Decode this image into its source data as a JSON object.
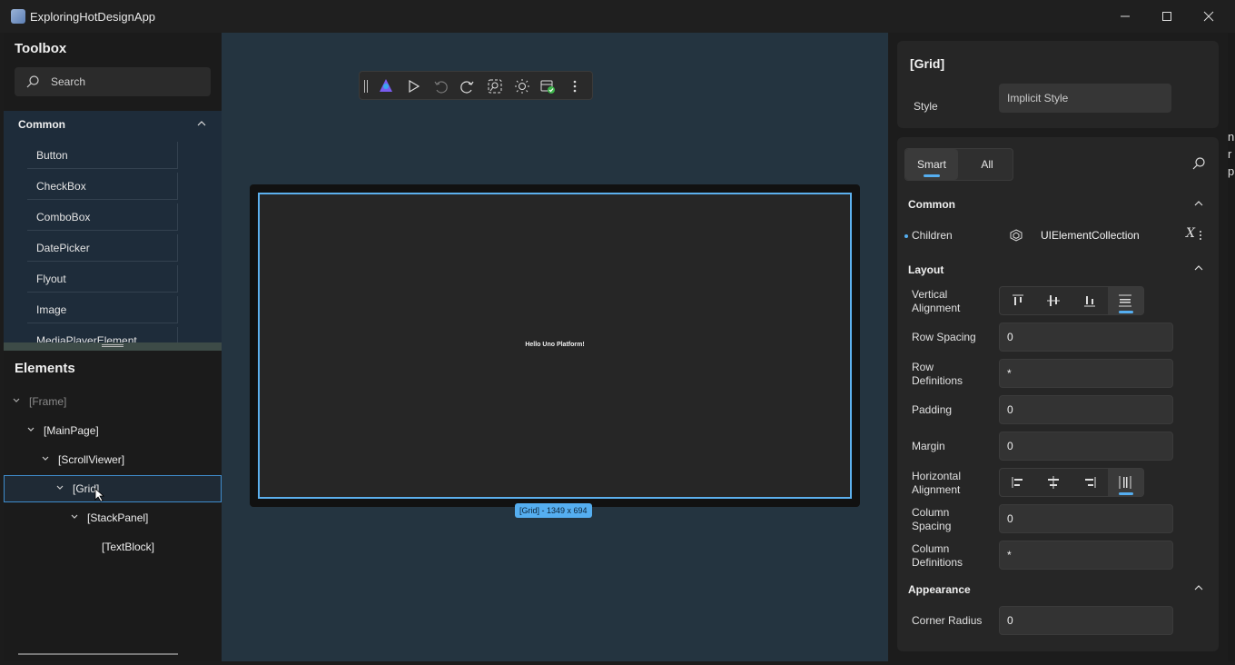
{
  "window": {
    "title": "ExploringHotDesignApp",
    "minimize": "—",
    "maximize": "☐",
    "close": "✕"
  },
  "toolbox": {
    "title": "Toolbox",
    "search_placeholder": "Search",
    "section": "Common",
    "items": [
      "Button",
      "CheckBox",
      "ComboBox",
      "DatePicker",
      "Flyout",
      "Image",
      "MediaPlayerElement"
    ]
  },
  "elements": {
    "title": "Elements",
    "tree": [
      "[Frame]",
      "[MainPage]",
      "[ScrollViewer]",
      "[Grid]",
      "[StackPanel]",
      "[TextBlock]"
    ]
  },
  "canvas": {
    "content_text": "Hello Uno Platform!",
    "selection_badge": "[Grid] - 1349 x 694"
  },
  "properties": {
    "header": "[Grid]",
    "style_label": "Style",
    "style_value": "Implicit Style",
    "tabs": [
      "Smart",
      "All"
    ],
    "common_section": "Common",
    "children_label": "Children",
    "children_value": "UIElementCollection",
    "children_action": "X",
    "layout_section": "Layout",
    "vertical_alignment_label": "Vertical Alignment",
    "row_spacing_label": "Row Spacing",
    "row_spacing_value": "0",
    "row_definitions_label": "Row Definitions",
    "row_definitions_value": "*",
    "padding_label": "Padding",
    "padding_value": "0",
    "margin_label": "Margin",
    "margin_value": "0",
    "horizontal_alignment_label": "Horizontal Alignment",
    "column_spacing_label": "Column Spacing",
    "column_spacing_value": "0",
    "column_definitions_label": "Column Definitions",
    "column_definitions_value": "*",
    "appearance_section": "Appearance",
    "corner_radius_label": "Corner Radius",
    "corner_radius_value": "0"
  },
  "background_peek": [
    "n",
    "r",
    "p"
  ],
  "colors": {
    "accent": "#55aef0",
    "canvas_bg": "#243440",
    "panel_bg": "#1c1c1c"
  }
}
